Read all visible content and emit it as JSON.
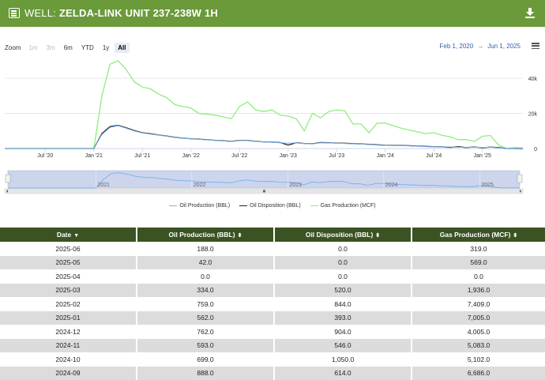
{
  "header": {
    "prefix": "WELL:",
    "title": "ZELDA-LINK UNIT 237-238W 1H"
  },
  "zoom": {
    "label": "Zoom",
    "buttons": [
      {
        "label": "1m",
        "state": "disabled"
      },
      {
        "label": "3m",
        "state": "disabled"
      },
      {
        "label": "6m",
        "state": "normal"
      },
      {
        "label": "YTD",
        "state": "normal"
      },
      {
        "label": "1y",
        "state": "normal"
      },
      {
        "label": "All",
        "state": "active"
      }
    ]
  },
  "range": {
    "from": "Feb 1, 2020",
    "to": "Jun 1, 2025",
    "arrow": "→"
  },
  "chart_data": {
    "type": "line",
    "x_ticks": [
      "Jul '20",
      "Jan '21",
      "Jul '21",
      "Jan '22",
      "Jul '22",
      "Jan '23",
      "Jul '23",
      "Jan '24",
      "Jul '24",
      "Jan '25"
    ],
    "y_ticks": [
      "0",
      "20k",
      "40k"
    ],
    "ylim": [
      0,
      54000
    ],
    "navigator_labels": [
      "2021",
      "2022",
      "2023",
      "2024",
      "2025"
    ],
    "series": [
      {
        "name": "Oil Production (BBL)",
        "color": "#7cb5ec",
        "x": [
          "2020-02",
          "2020-03",
          "2020-04",
          "2020-05",
          "2020-06",
          "2020-07",
          "2020-08",
          "2020-09",
          "2020-10",
          "2020-11",
          "2020-12",
          "2021-01",
          "2021-02",
          "2021-03",
          "2021-04",
          "2021-05",
          "2021-06",
          "2021-07",
          "2021-08",
          "2021-09",
          "2021-10",
          "2021-11",
          "2021-12",
          "2022-01",
          "2022-02",
          "2022-03",
          "2022-04",
          "2022-05",
          "2022-06",
          "2022-07",
          "2022-08",
          "2022-09",
          "2022-10",
          "2022-11",
          "2022-12",
          "2023-01",
          "2023-02",
          "2023-03",
          "2023-04",
          "2023-05",
          "2023-06",
          "2023-07",
          "2023-08",
          "2023-09",
          "2023-10",
          "2023-11",
          "2023-12",
          "2024-01",
          "2024-02",
          "2024-03",
          "2024-04",
          "2024-05",
          "2024-06",
          "2024-07",
          "2024-08",
          "2024-09",
          "2024-10",
          "2024-11",
          "2024-12",
          "2025-01",
          "2025-02",
          "2025-03",
          "2025-04",
          "2025-05",
          "2025-06"
        ],
        "values": [
          0,
          0,
          0,
          0,
          0,
          0,
          0,
          0,
          0,
          0,
          0,
          0,
          8000,
          12000,
          13000,
          11500,
          10000,
          8800,
          8200,
          7600,
          7000,
          6300,
          5800,
          5500,
          5200,
          4900,
          4600,
          4300,
          4000,
          4500,
          4500,
          4000,
          3700,
          3500,
          3300,
          3000,
          3200,
          2800,
          2600,
          3300,
          3200,
          3000,
          2900,
          2700,
          2500,
          2300,
          2000,
          1800,
          1700,
          1600,
          1500,
          1300,
          1100,
          1000,
          950,
          888,
          699,
          593,
          762,
          562,
          759,
          334,
          0,
          42,
          188
        ]
      },
      {
        "name": "Oil Disposition (BBL)",
        "color": "#222222",
        "x": [
          "2020-02",
          "2020-03",
          "2020-04",
          "2020-05",
          "2020-06",
          "2020-07",
          "2020-08",
          "2020-09",
          "2020-10",
          "2020-11",
          "2020-12",
          "2021-01",
          "2021-02",
          "2021-03",
          "2021-04",
          "2021-05",
          "2021-06",
          "2021-07",
          "2021-08",
          "2021-09",
          "2021-10",
          "2021-11",
          "2021-12",
          "2022-01",
          "2022-02",
          "2022-03",
          "2022-04",
          "2022-05",
          "2022-06",
          "2022-07",
          "2022-08",
          "2022-09",
          "2022-10",
          "2022-11",
          "2022-12",
          "2023-01",
          "2023-02",
          "2023-03",
          "2023-04",
          "2023-05",
          "2023-06",
          "2023-07",
          "2023-08",
          "2023-09",
          "2023-10",
          "2023-11",
          "2023-12",
          "2024-01",
          "2024-02",
          "2024-03",
          "2024-04",
          "2024-05",
          "2024-06",
          "2024-07",
          "2024-08",
          "2024-09",
          "2024-10",
          "2024-11",
          "2024-12",
          "2025-01",
          "2025-02",
          "2025-03",
          "2025-04",
          "2025-05",
          "2025-06"
        ],
        "values": [
          0,
          0,
          0,
          0,
          0,
          0,
          0,
          0,
          0,
          0,
          0,
          0,
          8500,
          12500,
          13200,
          11800,
          10200,
          9000,
          8400,
          7700,
          7100,
          6400,
          5900,
          5600,
          5300,
          5000,
          4700,
          4400,
          4100,
          4600,
          4600,
          4100,
          3800,
          3600,
          3400,
          2000,
          3300,
          2900,
          2700,
          3400,
          3300,
          3100,
          3000,
          2800,
          2600,
          2400,
          2100,
          1900,
          1800,
          1700,
          1600,
          1400,
          1200,
          1100,
          1000,
          614,
          1050,
          546,
          904,
          393,
          844,
          520,
          0,
          0,
          0
        ]
      },
      {
        "name": "Gas Production (MCF)",
        "color": "#90ed7d",
        "x": [
          "2020-02",
          "2020-03",
          "2020-04",
          "2020-05",
          "2020-06",
          "2020-07",
          "2020-08",
          "2020-09",
          "2020-10",
          "2020-11",
          "2020-12",
          "2021-01",
          "2021-02",
          "2021-03",
          "2021-04",
          "2021-05",
          "2021-06",
          "2021-07",
          "2021-08",
          "2021-09",
          "2021-10",
          "2021-11",
          "2021-12",
          "2022-01",
          "2022-02",
          "2022-03",
          "2022-04",
          "2022-05",
          "2022-06",
          "2022-07",
          "2022-08",
          "2022-09",
          "2022-10",
          "2022-11",
          "2022-12",
          "2023-01",
          "2023-02",
          "2023-03",
          "2023-04",
          "2023-05",
          "2023-06",
          "2023-07",
          "2023-08",
          "2023-09",
          "2023-10",
          "2023-11",
          "2023-12",
          "2024-01",
          "2024-02",
          "2024-03",
          "2024-04",
          "2024-05",
          "2024-06",
          "2024-07",
          "2024-08",
          "2024-09",
          "2024-10",
          "2024-11",
          "2024-12",
          "2025-01",
          "2025-02",
          "2025-03",
          "2025-04",
          "2025-05",
          "2025-06"
        ],
        "values": [
          0,
          0,
          0,
          0,
          0,
          0,
          0,
          0,
          0,
          0,
          0,
          0,
          30000,
          48000,
          50000,
          45000,
          38000,
          35000,
          34000,
          31000,
          29000,
          25000,
          24000,
          23000,
          20000,
          19500,
          19000,
          18000,
          17000,
          24000,
          26500,
          22000,
          21000,
          22000,
          19000,
          18500,
          17000,
          10000,
          20000,
          17500,
          21000,
          22000,
          21500,
          14000,
          14000,
          9000,
          14500,
          14500,
          13000,
          11500,
          10500,
          9500,
          8500,
          9000,
          7500,
          6686,
          5102,
          5083,
          4005,
          7005,
          7409,
          1936,
          0,
          569,
          319
        ]
      }
    ]
  },
  "legend": [
    {
      "label": "Oil Production (BBL)",
      "color": "#7cb5ec"
    },
    {
      "label": "Oil Disposition (BBL)",
      "color": "#222222"
    },
    {
      "label": "Gas Production (MCF)",
      "color": "#90ed7d"
    }
  ],
  "table": {
    "headers": [
      {
        "label": "Date",
        "sort": "▼"
      },
      {
        "label": "Oil Production (BBL)",
        "sort": "⬍"
      },
      {
        "label": "Oil Disposition (BBL)",
        "sort": "⬍"
      },
      {
        "label": "Gas Production (MCF)",
        "sort": "⬍"
      }
    ],
    "rows": [
      [
        "2025-06",
        "188.0",
        "0.0",
        "319.0"
      ],
      [
        "2025-05",
        "42.0",
        "0.0",
        "569.0"
      ],
      [
        "2025-04",
        "0.0",
        "0.0",
        "0.0"
      ],
      [
        "2025-03",
        "334.0",
        "520.0",
        "1,936.0"
      ],
      [
        "2025-02",
        "759.0",
        "844.0",
        "7,409.0"
      ],
      [
        "2025-01",
        "562.0",
        "393.0",
        "7,005.0"
      ],
      [
        "2024-12",
        "762.0",
        "904.0",
        "4,005.0"
      ],
      [
        "2024-11",
        "593.0",
        "546.0",
        "5,083.0"
      ],
      [
        "2024-10",
        "699.0",
        "1,050.0",
        "5,102.0"
      ],
      [
        "2024-09",
        "888.0",
        "614.0",
        "6,686.0"
      ]
    ]
  }
}
